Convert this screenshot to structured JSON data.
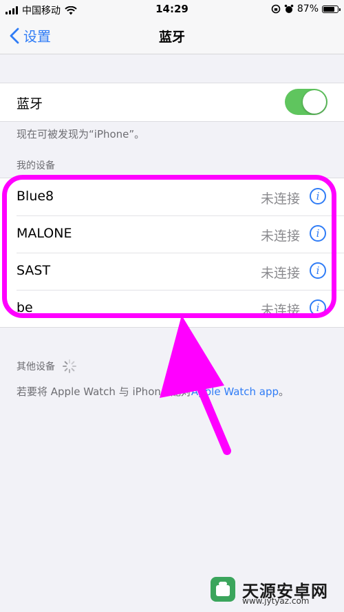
{
  "status_bar": {
    "carrier": "中国移动",
    "time": "14:29",
    "battery": "87%",
    "battery_level": 0.87
  },
  "nav": {
    "back_label": "设置",
    "title": "蓝牙"
  },
  "bluetooth": {
    "label": "蓝牙",
    "enabled": true,
    "discoverable_note": "现在可被发现为“iPhone”。"
  },
  "my_devices": {
    "header": "我的设备",
    "items": [
      {
        "name": "Blue8",
        "status": "未连接"
      },
      {
        "name": "MALONE",
        "status": "未连接"
      },
      {
        "name": "SAST",
        "status": "未连接"
      },
      {
        "name": "be",
        "status": "未连接"
      }
    ]
  },
  "other_devices": {
    "header": "其他设备",
    "note_prefix": "若要将 Apple Watch 与 iPhone 配对",
    "note_link": "Apple Watch app",
    "note_suffix": "。"
  },
  "annotation": {
    "highlight_color": "#ff00ff"
  },
  "watermark": {
    "text": "天源安卓网",
    "url": "www.jytyaz.com"
  },
  "colors": {
    "accent": "#2f7cf6",
    "toggle_on": "#5fc55e",
    "background": "#f2f2f7"
  },
  "icons": [
    "signal-icon",
    "wifi-icon",
    "lock-rotation-icon",
    "alarm-icon",
    "battery-icon",
    "chevron-left-icon",
    "info-icon",
    "spinner-icon"
  ]
}
